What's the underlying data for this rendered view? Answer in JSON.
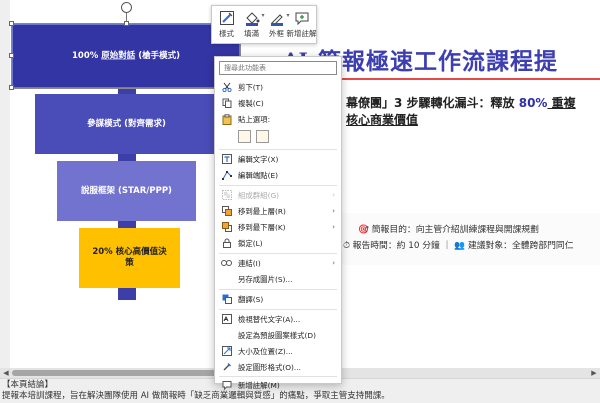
{
  "funnel": {
    "level1": "100% 原始對話 (槍手模式)",
    "level1_prefix": "100% ",
    "level1_underlined": "原始對話",
    "level1_suffix": " (槍手模式)",
    "level2": "參謀模式 (對齊需求)",
    "level3": "說服框架 (STAR/PPP)",
    "level4_line1": "20% 核心高價值決",
    "level4_line2": "策"
  },
  "slide": {
    "title_badge": "AI",
    "title": "簡報極速工作流課程提",
    "body_line1_a": "幕僚團」3 步驟轉化漏斗：釋放 ",
    "body_line1_b": "80%",
    "body_line1_c": " 重複",
    "body_line2": "核心商業價值",
    "info_line1": "🎯 簡報目的：向主管介紹訓練課程與開課規劃",
    "info_line2": "⏱ 報告時間：約 10 分鐘 ｜ 👥 建議對象：全體跨部門同仁"
  },
  "notes": {
    "line1": "【本頁結論】",
    "line2": "提報本培訓課程，旨在解決團隊使用 AI 做簡報時「缺乏商業邏輯與質感」的痛點，爭取主管支持開課。"
  },
  "mini_toolbar": {
    "style": "樣式",
    "fill": "填滿",
    "outline": "外框",
    "new_comment": "新增註解"
  },
  "context_menu": {
    "search_placeholder": "搜尋此功能表",
    "cut": "剪下(T)",
    "copy": "複製(C)",
    "paste_options": "貼上選項:",
    "edit_text": "編輯文字(X)",
    "edit_points": "編輯端點(E)",
    "group": "組成群組(G)",
    "bring_forward": "移到最上層(R)",
    "send_backward": "移到最下層(K)",
    "lock": "鎖定(L)",
    "link": "連結(I)",
    "save_as_picture": "另存成圖片(S)...",
    "translate": "翻譯(S)",
    "alt_text": "檢視替代文字(A)...",
    "set_default_shape": "設定為預設圖案樣式(D)",
    "size_position": "大小及位置(Z)...",
    "format_shape": "設定圖形格式(O)...",
    "new_comment": "新增註解(M)"
  },
  "colors": {
    "funnel1": "#3435a4",
    "funnel2": "#4a4db8",
    "funnel3": "#7273cf",
    "funnel4": "#ffc000",
    "title": "#3d3fb0",
    "accent_rule": "#e64848"
  }
}
